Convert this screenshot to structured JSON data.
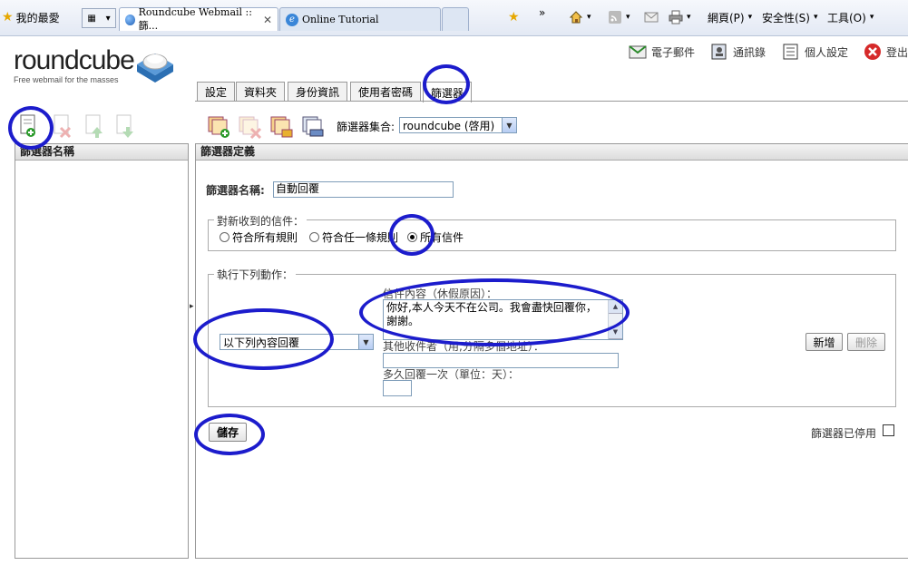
{
  "browser": {
    "favorites_label": "我的最愛",
    "tabs": [
      {
        "label": "Roundcube Webmail :: 篩...",
        "active": true
      },
      {
        "label": "Online Tutorial",
        "active": false
      }
    ],
    "menu": {
      "page": "網頁(P)",
      "safety": "安全性(S)",
      "tools": "工具(O)"
    },
    "icons": [
      "home-icon",
      "rss-icon",
      "mail-icon",
      "print-icon"
    ]
  },
  "app": {
    "logo_text": "roundcube",
    "logo_tagline": "Free webmail for the masses",
    "topnav": [
      {
        "label": "電子郵件",
        "icon": "email-icon"
      },
      {
        "label": "通訊錄",
        "icon": "addressbook-icon"
      },
      {
        "label": "個人設定",
        "icon": "settings-icon"
      },
      {
        "label": "登出",
        "icon": "logout-icon"
      }
    ],
    "settings_tabs": [
      {
        "label": "設定",
        "active": false
      },
      {
        "label": "資料夾",
        "active": false
      },
      {
        "label": "身份資訊",
        "active": false
      },
      {
        "label": "使用者密碼",
        "active": false
      },
      {
        "label": "篩選器",
        "active": true
      }
    ],
    "filterset_label": "篩選器集合:",
    "filterset_value": "roundcube (啓用)"
  },
  "left_panel": {
    "header": "篩選器名稱"
  },
  "filter": {
    "header": "篩選器定義",
    "name_label": "篩選器名稱:",
    "name_value": "自動回覆",
    "incoming_legend": "對新收到的信件：",
    "radios": [
      {
        "label": "符合所有規則",
        "checked": false
      },
      {
        "label": "符合任一條規則",
        "checked": false
      },
      {
        "label": "所有信件",
        "checked": true
      }
    ],
    "actions_legend": "執行下列動作：",
    "action_value": "以下列內容回覆",
    "body_label": "信件內容（休假原因）：",
    "body_text_line1": "你好,本人今天不在公司。我會盡快回覆你，",
    "body_text_line2": "謝謝。",
    "addresses_label": "其他收件者（用,分隔多個地址）：",
    "days_label": "多久回覆一次（單位：天）：",
    "add_button": "新增",
    "delete_button": "刪除",
    "save_button": "儲存",
    "disabled_label": "篩選器已停用",
    "disabled_checked": false
  },
  "colors": {
    "annotation": "#1c1ccc",
    "border": "#999999",
    "header_bg": "#dcdcdc"
  }
}
